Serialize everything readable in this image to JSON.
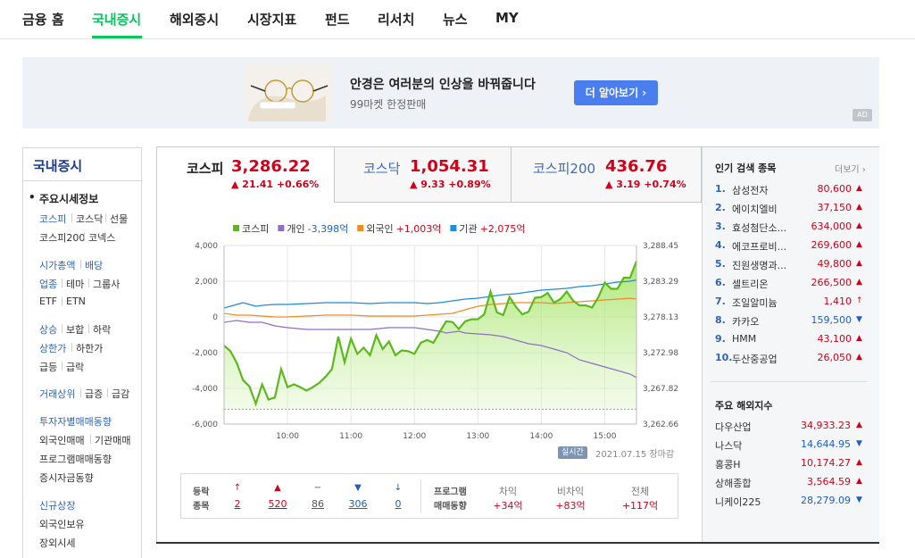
{
  "nav": {
    "items": [
      "금융 홈",
      "국내증시",
      "해외증시",
      "시장지표",
      "펀드",
      "리서치",
      "뉴스",
      "MY"
    ]
  },
  "ad": {
    "title": "안경은 여러분의 인상을 바꿔줍니다",
    "sub": "99마켓 한정판매",
    "button": "더 알아보기 ›",
    "badge": "AD"
  },
  "sidebar": {
    "title": "국내증시",
    "items": {
      "main_summary": "주요시세정보",
      "kospi": "코스피",
      "kosdaq": "코스닥",
      "futures": "선물",
      "kospi200": "코스피200",
      "konex": "코넥스",
      "market_cap": "시가총액",
      "dividend": "배당",
      "sector": "업종",
      "theme": "테마",
      "group": "그룹사",
      "etf": "ETF",
      "etn": "ETN",
      "rise": "상승",
      "flat": "보합",
      "fall": "하락",
      "upper_limit": "상한가",
      "lower_limit": "하한가",
      "surge": "급등",
      "plunge": "급락",
      "volume_top": "거래상위",
      "vol_up": "급증",
      "vol_down": "급감",
      "investor_trend": "투자자별매매동향",
      "foreign_trade": "외국인매매",
      "inst_trade": "기관매매",
      "program_trend": "프로그램매매동향",
      "deposit_trend": "증시자금동향",
      "new_listing": "신규상장",
      "foreign_hold": "외국인보유",
      "otc": "장외시세"
    }
  },
  "indices": [
    {
      "name": "코스피",
      "value": "3,286.22",
      "change": "▲ 21.41 +0.66%"
    },
    {
      "name": "코스닥",
      "value": "1,054.31",
      "change": "▲ 9.33 +0.89%"
    },
    {
      "name": "코스피200",
      "value": "436.76",
      "change": "▲ 3.19 +0.74%"
    }
  ],
  "chart_data": {
    "type": "line",
    "legend": [
      {
        "name": "코스피",
        "color": "#5bb91b",
        "value": ""
      },
      {
        "name": "개인",
        "color": "#8e6fc4",
        "value": "-3,398억"
      },
      {
        "name": "외국인",
        "color": "#f08a24",
        "value": "+1,003억"
      },
      {
        "name": "기관",
        "color": "#1e8bdb",
        "value": "+2,075억"
      }
    ],
    "x_ticks": [
      "10:00",
      "11:00",
      "12:00",
      "13:00",
      "14:00",
      "15:00"
    ],
    "y_left_ticks": [
      "4,000",
      "2,000",
      "0",
      "-2,000",
      "-4,000",
      "-6,000"
    ],
    "y_right_ticks": [
      "3,288.45",
      "3,283.29",
      "3,278.13",
      "3,272.98",
      "3,267.82",
      "3,262.66"
    ],
    "y_left_range": [
      -6000,
      4000
    ],
    "prev_close": 3264.81,
    "kospi": [
      [
        9.0,
        3274.0
      ],
      [
        9.1,
        3273.2
      ],
      [
        9.2,
        3271.5
      ],
      [
        9.3,
        3269.0
      ],
      [
        9.4,
        3268.1
      ],
      [
        9.5,
        3265.6
      ],
      [
        9.6,
        3268.4
      ],
      [
        9.7,
        3266.2
      ],
      [
        9.8,
        3266.5
      ],
      [
        9.9,
        3270.6
      ],
      [
        10.0,
        3268.0
      ],
      [
        10.1,
        3268.4
      ],
      [
        10.2,
        3268.0
      ],
      [
        10.3,
        3267.5
      ],
      [
        10.4,
        3268.0
      ],
      [
        10.5,
        3268.6
      ],
      [
        10.6,
        3269.5
      ],
      [
        10.7,
        3270.6
      ],
      [
        10.8,
        3275.3
      ],
      [
        10.9,
        3271.6
      ],
      [
        11.0,
        3275.0
      ],
      [
        11.1,
        3272.8
      ],
      [
        11.2,
        3273.7
      ],
      [
        11.3,
        3272.6
      ],
      [
        11.4,
        3275.5
      ],
      [
        11.5,
        3273.5
      ],
      [
        11.6,
        3274.6
      ],
      [
        11.7,
        3272.6
      ],
      [
        11.8,
        3273.3
      ],
      [
        11.9,
        3273.2
      ],
      [
        12.0,
        3272.8
      ],
      [
        12.1,
        3274.4
      ],
      [
        12.2,
        3274.8
      ],
      [
        12.3,
        3274.4
      ],
      [
        12.4,
        3276.0
      ],
      [
        12.5,
        3277.5
      ],
      [
        12.6,
        3277.4
      ],
      [
        12.7,
        3276.4
      ],
      [
        12.8,
        3277.5
      ],
      [
        12.9,
        3277.8
      ],
      [
        13.0,
        3277.8
      ],
      [
        13.1,
        3278.5
      ],
      [
        13.2,
        3281.8
      ],
      [
        13.3,
        3278.8
      ],
      [
        13.4,
        3278.4
      ],
      [
        13.5,
        3281.0
      ],
      [
        13.6,
        3279.6
      ],
      [
        13.7,
        3278.5
      ],
      [
        13.8,
        3278.9
      ],
      [
        13.9,
        3280.9
      ],
      [
        14.0,
        3281.0
      ],
      [
        14.1,
        3281.6
      ],
      [
        14.2,
        3280.2
      ],
      [
        14.3,
        3280.7
      ],
      [
        14.4,
        3281.8
      ],
      [
        14.5,
        3280.5
      ],
      [
        14.6,
        3279.8
      ],
      [
        14.7,
        3279.8
      ],
      [
        14.8,
        3279.5
      ],
      [
        14.9,
        3281.0
      ],
      [
        15.0,
        3283.1
      ],
      [
        15.1,
        3282.2
      ],
      [
        15.2,
        3282.2
      ],
      [
        15.3,
        3283.8
      ],
      [
        15.4,
        3283.8
      ],
      [
        15.5,
        3286.2
      ]
    ],
    "individual": [
      [
        9.0,
        -300
      ],
      [
        9.2,
        -200
      ],
      [
        9.4,
        -300
      ],
      [
        9.6,
        -300
      ],
      [
        9.8,
        -500
      ],
      [
        10.0,
        -600
      ],
      [
        10.3,
        -700
      ],
      [
        10.6,
        -700
      ],
      [
        11.0,
        -700
      ],
      [
        11.3,
        -700
      ],
      [
        11.6,
        -600
      ],
      [
        12.0,
        -600
      ],
      [
        12.2,
        -700
      ],
      [
        12.4,
        -800
      ],
      [
        12.5,
        -900
      ],
      [
        12.7,
        -800
      ],
      [
        12.8,
        -900
      ],
      [
        13.0,
        -950
      ],
      [
        13.2,
        -1000
      ],
      [
        13.4,
        -1100
      ],
      [
        13.6,
        -1300
      ],
      [
        13.8,
        -1500
      ],
      [
        14.0,
        -1600
      ],
      [
        14.2,
        -1800
      ],
      [
        14.4,
        -2000
      ],
      [
        14.6,
        -2400
      ],
      [
        14.8,
        -2600
      ],
      [
        15.0,
        -2800
      ],
      [
        15.2,
        -3000
      ],
      [
        15.4,
        -3200
      ],
      [
        15.5,
        -3398
      ]
    ],
    "foreign": [
      [
        9.0,
        200
      ],
      [
        9.2,
        100
      ],
      [
        9.4,
        100
      ],
      [
        9.6,
        50
      ],
      [
        9.8,
        0
      ],
      [
        10.0,
        0
      ],
      [
        10.3,
        50
      ],
      [
        10.6,
        100
      ],
      [
        11.0,
        100
      ],
      [
        11.3,
        50
      ],
      [
        11.6,
        50
      ],
      [
        12.0,
        50
      ],
      [
        12.2,
        100
      ],
      [
        12.4,
        150
      ],
      [
        12.6,
        200
      ],
      [
        12.8,
        400
      ],
      [
        13.0,
        600
      ],
      [
        13.2,
        700
      ],
      [
        13.4,
        750
      ],
      [
        13.6,
        800
      ],
      [
        14.0,
        800
      ],
      [
        14.2,
        750
      ],
      [
        14.4,
        800
      ],
      [
        14.6,
        850
      ],
      [
        14.8,
        900
      ],
      [
        15.0,
        950
      ],
      [
        15.2,
        1000
      ],
      [
        15.4,
        1050
      ],
      [
        15.5,
        1003
      ]
    ],
    "institution": [
      [
        9.0,
        500
      ],
      [
        9.1,
        600
      ],
      [
        9.2,
        700
      ],
      [
        9.3,
        800
      ],
      [
        9.4,
        700
      ],
      [
        9.5,
        600
      ],
      [
        9.6,
        650
      ],
      [
        9.8,
        700
      ],
      [
        10.0,
        700
      ],
      [
        10.3,
        750
      ],
      [
        10.6,
        800
      ],
      [
        11.0,
        800
      ],
      [
        11.3,
        750
      ],
      [
        11.6,
        800
      ],
      [
        12.0,
        800
      ],
      [
        12.2,
        750
      ],
      [
        12.4,
        800
      ],
      [
        12.6,
        900
      ],
      [
        12.8,
        1000
      ],
      [
        13.0,
        1050
      ],
      [
        13.2,
        1150
      ],
      [
        13.4,
        1250
      ],
      [
        13.6,
        1300
      ],
      [
        13.8,
        1400
      ],
      [
        14.0,
        1500
      ],
      [
        14.2,
        1550
      ],
      [
        14.4,
        1600
      ],
      [
        14.6,
        1700
      ],
      [
        14.8,
        1750
      ],
      [
        15.0,
        1850
      ],
      [
        15.2,
        1950
      ],
      [
        15.4,
        2000
      ],
      [
        15.5,
        2075
      ]
    ]
  },
  "chart_footer": {
    "badge": "실시간",
    "date": "2021.07.15 장마감"
  },
  "updown": {
    "label_top": "등락",
    "label_bottom": "종목",
    "counts": [
      {
        "icon": "↑",
        "value": "2",
        "color": "#d0021b"
      },
      {
        "icon": "▲",
        "value": "520",
        "color": "#d0021b"
      },
      {
        "icon": "−",
        "value": "86",
        "color": "#555555"
      },
      {
        "icon": "▼",
        "value": "306",
        "color": "#1d5fc4"
      },
      {
        "icon": "↓",
        "value": "0",
        "color": "#1d5fc4"
      }
    ],
    "program_top": "프로그램",
    "program_bottom": "매매동향",
    "program": [
      {
        "head": "차익",
        "value": "+34억"
      },
      {
        "head": "비차익",
        "value": "+83억"
      },
      {
        "head": "전체",
        "value": "+117억"
      }
    ]
  },
  "popular": {
    "title": "인기 검색 종목",
    "more": "더보기 ›",
    "items": [
      {
        "rank": "1.",
        "name": "삼성전자",
        "price": "80,600",
        "dir": "▲",
        "color": "#d0021b"
      },
      {
        "rank": "2.",
        "name": "에이치엘비",
        "price": "37,150",
        "dir": "▲",
        "color": "#d0021b"
      },
      {
        "rank": "3.",
        "name": "효성첨단소...",
        "price": "634,000",
        "dir": "▲",
        "color": "#d0021b"
      },
      {
        "rank": "4.",
        "name": "에코프로비...",
        "price": "269,600",
        "dir": "▲",
        "color": "#d0021b"
      },
      {
        "rank": "5.",
        "name": "진원생명과...",
        "price": "49,800",
        "dir": "▲",
        "color": "#d0021b"
      },
      {
        "rank": "6.",
        "name": "셀트리온",
        "price": "266,500",
        "dir": "▲",
        "color": "#d0021b"
      },
      {
        "rank": "7.",
        "name": "조일알미늄",
        "price": "1,410",
        "dir": "↑",
        "color": "#d0021b"
      },
      {
        "rank": "8.",
        "name": "카카오",
        "price": "159,500",
        "dir": "▼",
        "color": "#1d5fc4"
      },
      {
        "rank": "9.",
        "name": "HMM",
        "price": "43,100",
        "dir": "▲",
        "color": "#d0021b"
      },
      {
        "rank": "10.",
        "name": "두산중공업",
        "price": "26,050",
        "dir": "▲",
        "color": "#d0021b"
      }
    ]
  },
  "world": {
    "title": "주요 해외지수",
    "items": [
      {
        "name": "다우산업",
        "value": "34,933.23",
        "dir": "▲",
        "color": "#d0021b"
      },
      {
        "name": "나스닥",
        "value": "14,644.95",
        "dir": "▼",
        "color": "#1d5fc4"
      },
      {
        "name": "홍콩H",
        "value": "10,174.27",
        "dir": "▲",
        "color": "#d0021b"
      },
      {
        "name": "상해종합",
        "value": "3,564.59",
        "dir": "▲",
        "color": "#d0021b"
      },
      {
        "name": "니케이225",
        "value": "28,279.09",
        "dir": "▼",
        "color": "#1d5fc4"
      }
    ]
  }
}
